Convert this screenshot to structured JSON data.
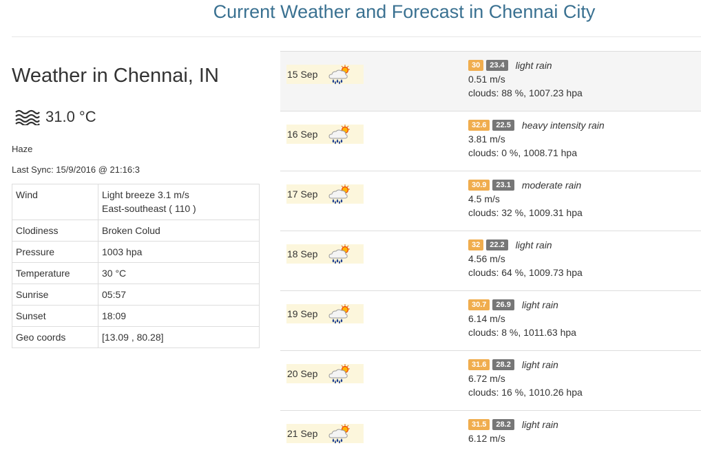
{
  "header": {
    "title": "Current Weather and Forecast in Chennai City"
  },
  "current": {
    "city": "Weather in Chennai, IN",
    "temp": "31.0 °C",
    "icon": "haze-icon",
    "condition": "Haze",
    "last_sync": "Last Sync: 15/9/2016 @ 21:16:3",
    "details": [
      {
        "label": "Wind",
        "value": "Light breeze 3.1 m/s",
        "value2": "East-southeast ( 110 )"
      },
      {
        "label": "Clodiness",
        "value": "Broken Colud"
      },
      {
        "label": "Pressure",
        "value": "1003 hpa"
      },
      {
        "label": "Temperature",
        "value": "30 °C"
      },
      {
        "label": "Sunrise",
        "value": "05:57"
      },
      {
        "label": "Sunset",
        "value": "18:09"
      },
      {
        "label": "Geo coords",
        "value": "[13.09 , 80.28]"
      }
    ]
  },
  "forecast": [
    {
      "date": "15 Sep",
      "max": "30",
      "min": "23.4",
      "desc": "light rain",
      "wind": "0.51 m/s",
      "clouds": "clouds: 88 %, 1007.23 hpa"
    },
    {
      "date": "16 Sep",
      "max": "32.6",
      "min": "22.5",
      "desc": "heavy intensity rain",
      "wind": "3.81 m/s",
      "clouds": "clouds: 0 %, 1008.71 hpa"
    },
    {
      "date": "17 Sep",
      "max": "30.9",
      "min": "23.1",
      "desc": "moderate rain",
      "wind": "4.5 m/s",
      "clouds": "clouds: 32 %, 1009.31 hpa"
    },
    {
      "date": "18 Sep",
      "max": "32",
      "min": "22.2",
      "desc": "light rain",
      "wind": "4.56 m/s",
      "clouds": "clouds: 64 %, 1009.73 hpa"
    },
    {
      "date": "19 Sep",
      "max": "30.7",
      "min": "26.9",
      "desc": "light rain",
      "wind": "6.14 m/s",
      "clouds": "clouds: 8 %, 1011.63 hpa"
    },
    {
      "date": "20 Sep",
      "max": "31.6",
      "min": "28.2",
      "desc": "light rain",
      "wind": "6.72 m/s",
      "clouds": "clouds: 16 %, 1010.26 hpa"
    },
    {
      "date": "21 Sep",
      "max": "31.5",
      "min": "28.2",
      "desc": "light rain",
      "wind": "6.12 m/s",
      "clouds": ""
    }
  ],
  "colors": {
    "title": "#3a7191",
    "max_badge": "#f0ad4e",
    "min_badge": "#777777",
    "date_bg": "#fcf6dc"
  },
  "icons": {
    "forecast_icon": "sun-cloud-rain-icon"
  }
}
